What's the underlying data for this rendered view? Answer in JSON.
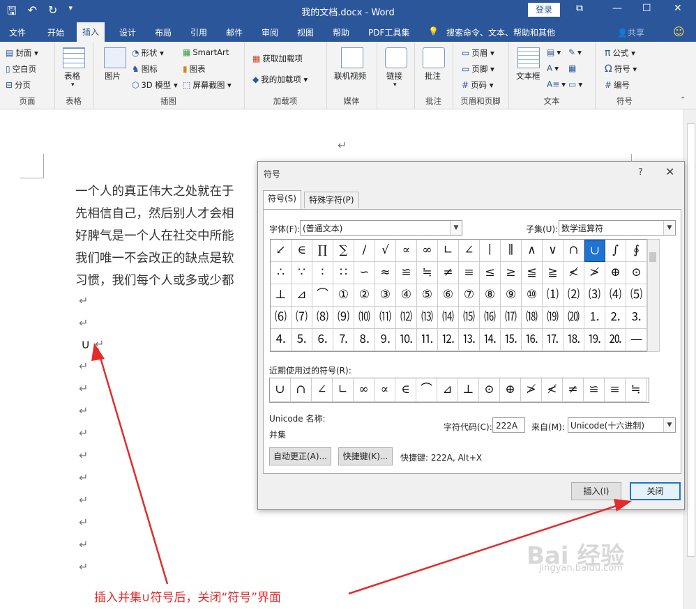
{
  "window": {
    "title": "我的文档.docx - Word",
    "login_label": "登录",
    "restore_icon": "ribbon-display-icon",
    "minimize": "—",
    "maximize": "☐",
    "close": "✕"
  },
  "tabs": [
    "文件",
    "开始",
    "插入",
    "设计",
    "布局",
    "引用",
    "邮件",
    "审阅",
    "视图",
    "帮助",
    "PDF工具集"
  ],
  "tell_me": "搜索命令、文本、帮助和其他",
  "share": "共享",
  "ribbon": {
    "groups": {
      "pages": {
        "label": "页面",
        "items": [
          "封面",
          "空白页",
          "分页"
        ]
      },
      "tables": {
        "label": "表格",
        "items": [
          "表格"
        ]
      },
      "illustrations": {
        "label": "插图",
        "items": [
          "图片",
          "形状",
          "图标",
          "3D 模型",
          "SmartArt",
          "图表",
          "屏幕截图"
        ]
      },
      "addins": {
        "label": "加载项",
        "items": [
          "获取加载项",
          "我的加载项"
        ]
      },
      "media": {
        "label": "媒体",
        "items": [
          "联机视频"
        ]
      },
      "links": {
        "label": "",
        "items": [
          "链接"
        ]
      },
      "comments": {
        "label": "批注",
        "items": [
          "批注"
        ]
      },
      "header_footer": {
        "label": "页眉和页脚",
        "items": [
          "页眉",
          "页脚",
          "页码"
        ]
      },
      "text": {
        "label": "文本",
        "items": [
          "文本框"
        ]
      },
      "symbols": {
        "label": "符号",
        "items": [
          "公式",
          "符号",
          "编号"
        ]
      }
    }
  },
  "document": {
    "lines": [
      "一个人的真正伟大之处就在于",
      "先相信自己，然后别人才会相",
      "好脾气是一个人在社交中所能",
      "我们唯一不会改正的缺点是软",
      "习惯，我们每个人或多或少都"
    ],
    "para_mark": "↵",
    "inserted_symbol": "∪"
  },
  "dialog": {
    "title": "符号",
    "help": "?",
    "close": "✕",
    "tabs": [
      "符号(S)",
      "特殊字符(P)"
    ],
    "font_label": "字体(F):",
    "font_value": "(普通文本)",
    "subset_label": "子集(U):",
    "subset_value": "数学运算符",
    "symbols": [
      "↙",
      "∈",
      "∏",
      "∑",
      "∕",
      "√",
      "∝",
      "∞",
      "∟",
      "∠",
      "∣",
      "∥",
      "∧",
      "∨",
      "∩",
      "∪",
      "∫",
      "∮",
      "∴",
      "∵",
      "∶",
      "∷",
      "∽",
      "≈",
      "≌",
      "≒",
      "≠",
      "≡",
      "≤",
      "≥",
      "≦",
      "≧",
      "≮",
      "≯",
      "⊕",
      "⊙",
      "⊥",
      "⊿",
      "⌒",
      "①",
      "②",
      "③",
      "④",
      "⑤",
      "⑥",
      "⑦",
      "⑧",
      "⑨",
      "⑩",
      "⑴",
      "⑵",
      "⑶",
      "⑷",
      "⑸",
      "⑹",
      "⑺",
      "⑻",
      "⑼",
      "⑽",
      "⑾",
      "⑿",
      "⒀",
      "⒁",
      "⒂",
      "⒃",
      "⒄",
      "⒅",
      "⒆",
      "⒇",
      "⒈",
      "⒉",
      "⒊",
      "⒋",
      "⒌",
      "⒍",
      "⒎",
      "⒏",
      "⒐",
      "⒑",
      "⒒",
      "⒓",
      "⒔",
      "⒕",
      "⒖",
      "⒗",
      "⒘",
      "⒙",
      "⒚",
      "⒛",
      "—"
    ],
    "selected_symbol": "∪",
    "recent_label": "近期使用过的符号(R):",
    "recent": [
      "∪",
      "∩",
      "∠",
      "∟",
      "∞",
      "∝",
      "∈",
      "⌒",
      "⊿",
      "⊥",
      "⊙",
      "⊕",
      "≯",
      "≮",
      "≠",
      "≌",
      "≡",
      "≒"
    ],
    "unicode_name_label": "Unicode 名称:",
    "unicode_name": "并集",
    "char_code_label": "字符代码(C):",
    "char_code": "222A",
    "from_label": "来自(M):",
    "from_value": "Unicode(十六进制)",
    "autocorrect_btn": "自动更正(A)...",
    "shortcut_btn": "快捷键(K)...",
    "shortcut_text": "快捷键: 222A, Alt+X",
    "insert_btn": "插入(I)",
    "close_btn": "关闭"
  },
  "annotation": "插入并集∪符号后，关闭“符号”界面",
  "watermark": {
    "brand": "Bai 经验",
    "url": "jingyan.baidu.com"
  },
  "colors": {
    "word_blue": "#2b579a",
    "annotation_red": "#e32b2b",
    "selection_blue": "#1f73d2"
  }
}
